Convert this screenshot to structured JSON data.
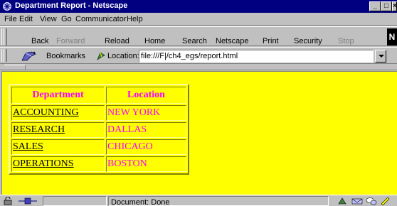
{
  "window": {
    "title": "Department Report - Netscape",
    "controls": {
      "minimize": "_",
      "maximize": "□",
      "close": "×"
    }
  },
  "menu": [
    "File",
    "Edit",
    "View",
    "Go",
    "Communicator",
    "Help"
  ],
  "toolbar": {
    "buttons": [
      {
        "label": "Back",
        "enabled": true
      },
      {
        "label": "Forward",
        "enabled": false
      },
      {
        "label": "Reload",
        "enabled": true
      },
      {
        "label": "Home",
        "enabled": true
      },
      {
        "label": "Search",
        "enabled": true
      },
      {
        "label": "Netscape",
        "enabled": true
      },
      {
        "label": "Print",
        "enabled": true
      },
      {
        "label": "Security",
        "enabled": true
      },
      {
        "label": "Stop",
        "enabled": false
      }
    ],
    "logo": "N"
  },
  "location_bar": {
    "bookmarks_label": "Bookmarks",
    "location_label": "Location:",
    "url": "file:///F|/ch4_egs/report.html"
  },
  "report": {
    "headers": {
      "department": "Department",
      "location": "Location"
    },
    "rows": [
      {
        "department": "ACCOUNTING",
        "location": "NEW YORK"
      },
      {
        "department": "RESEARCH",
        "location": "DALLAS"
      },
      {
        "department": "SALES",
        "location": "CHICAGO"
      },
      {
        "department": "OPERATIONS",
        "location": "BOSTON"
      }
    ]
  },
  "status": {
    "text": "Document: Done"
  },
  "colors": {
    "page_bg": "#ffff00",
    "header_text": "#ff00ff",
    "location_text": "#ff00ff",
    "titlebar": "#000080"
  }
}
